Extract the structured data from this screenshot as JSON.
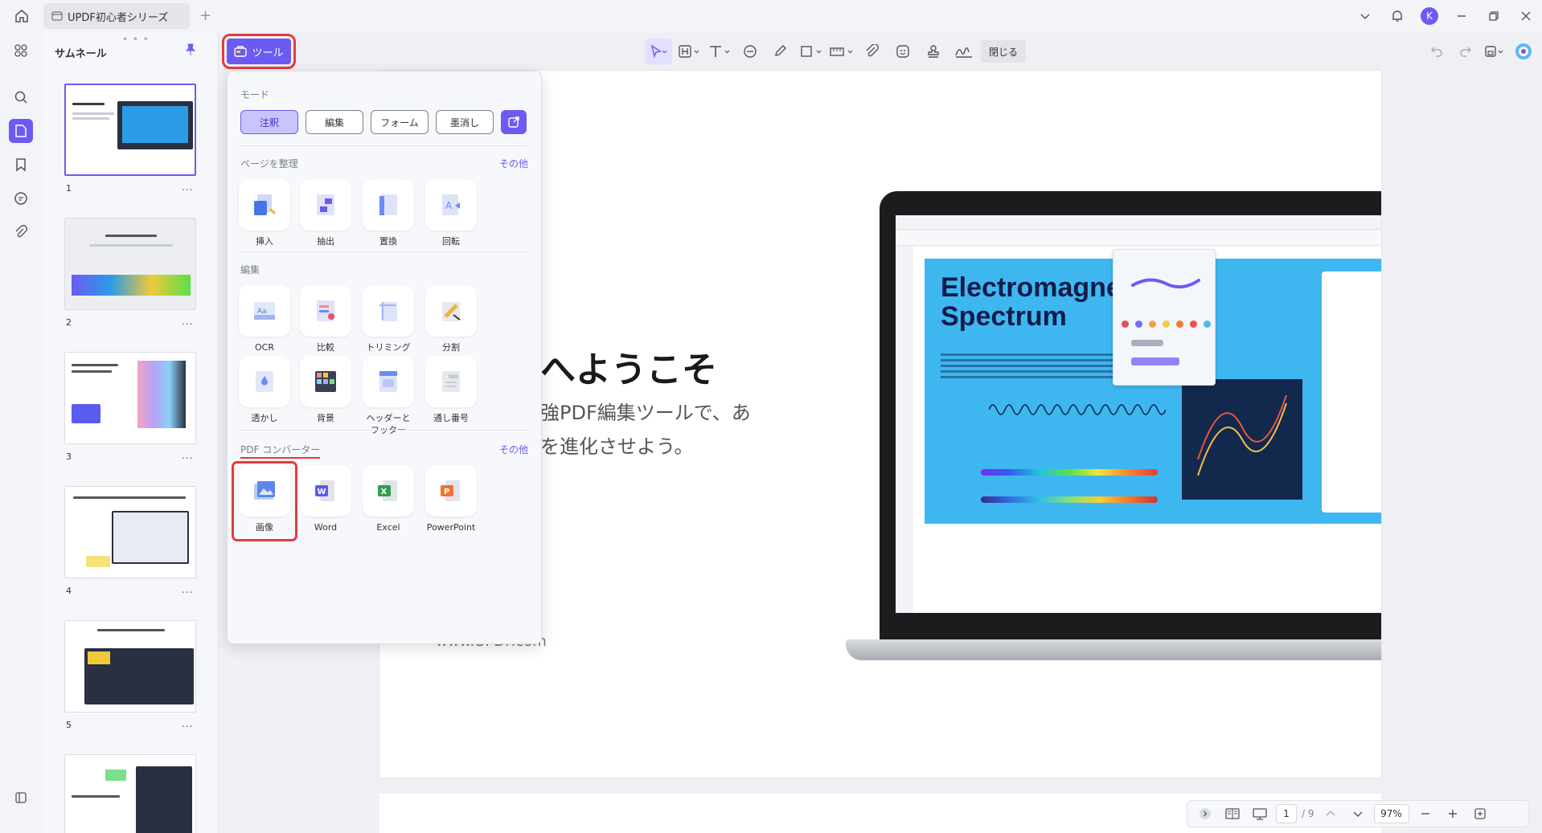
{
  "titlebar": {
    "tab_title": "UPDF初心者シリーズ",
    "avatar_initial": "K",
    "add_tab": "+"
  },
  "thumbnails": {
    "title": "サムネール",
    "pages": [
      "1",
      "2",
      "3",
      "4",
      "5"
    ],
    "more": "...",
    "grip": "• • •"
  },
  "toolbar": {
    "tools_label": "ツール",
    "close_label": "閉じる"
  },
  "dropdown": {
    "mode_title": "モード",
    "modes": [
      "注釈",
      "編集",
      "フォーム",
      "墨消し"
    ],
    "organize_title": "ページを整理",
    "organize_more": "その他",
    "organize_tools": [
      "挿入",
      "抽出",
      "置換",
      "回転"
    ],
    "edit_title": "編集",
    "edit_tools_row1": [
      "OCR",
      "比較",
      "トリミング",
      "分割"
    ],
    "edit_tools_row2": [
      "透かし",
      "背景",
      "ヘッダーと\nフッター",
      "通し番号"
    ],
    "converter_title": "PDF コンバーター",
    "converter_more": "その他",
    "converter_tools": [
      "画像",
      "Word",
      "Excel",
      "PowerPoint"
    ]
  },
  "document": {
    "heading": "へようこそ",
    "sub_line1": "強PDF編集ツールで、あ",
    "sub_line2": "を進化させよう。",
    "site": "www.UPDF.com",
    "laptop_title_line1": "Electromagne",
    "laptop_title_line2": "Spectrum"
  },
  "statusbar": {
    "current_page": "1",
    "total_pages": "/ 9",
    "zoom": "97%"
  },
  "colors": {
    "accent": "#6b5bf3",
    "highlight_red": "#e43b3b"
  }
}
